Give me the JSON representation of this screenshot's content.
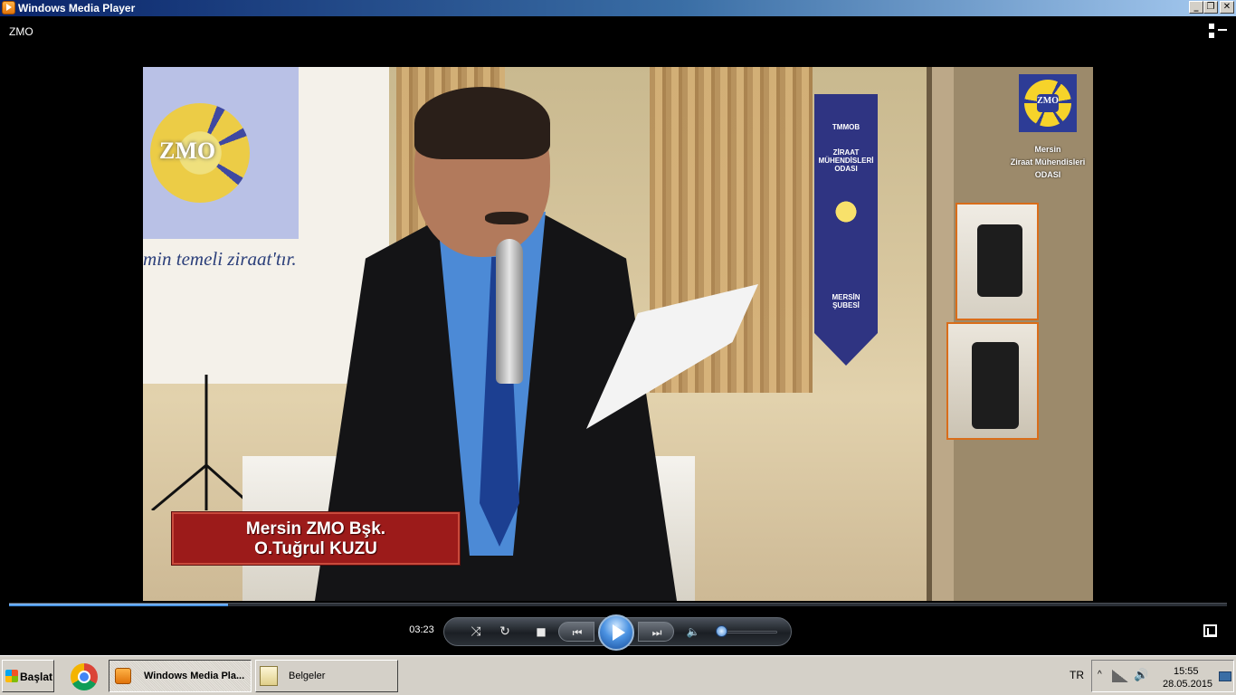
{
  "window": {
    "title": "Windows Media Player",
    "buttons": {
      "minimize": "_",
      "maximize": "❐",
      "close": "✕"
    }
  },
  "player": {
    "track_title": "ZMO",
    "elapsed_time": "03:23",
    "seek_progress": 0.18,
    "volume_level": 0.06,
    "accent_color": "#2e7fd6",
    "video": {
      "lower_third_line1": "Mersin ZMO Bşk.",
      "lower_third_line2": "O.Tuğrul KUZU",
      "logo_text": "ZMO",
      "org_line1": "Mersin",
      "org_line2": "Ziraat Mühendisleri",
      "org_line3": "ODASI",
      "screen_logo": "ZMO",
      "screen_slogan": "min temeli ziraat'tır.",
      "banner_top": "TMMOB",
      "banner_mid": "ZİRAAT MÜHENDİSLERİ ODASI",
      "banner_bottom": "MERSİN ŞUBESİ"
    },
    "controls": {
      "shuffle_icon": "⤨",
      "repeat_icon": "↻",
      "stop_icon": "■",
      "previous_icon": "⏮",
      "next_icon": "⏭",
      "mute_icon": "🔈"
    }
  },
  "taskbar": {
    "start_label": "Başlat",
    "items": [
      {
        "label": "Windows Media Pla...",
        "icon": "media-player-icon",
        "active": true
      },
      {
        "label": "Belgeler",
        "icon": "folder-icon",
        "active": false
      }
    ],
    "quick_launch": "chrome-icon",
    "language": "TR",
    "clock_time": "15:55",
    "clock_date": "28.05.2015"
  }
}
